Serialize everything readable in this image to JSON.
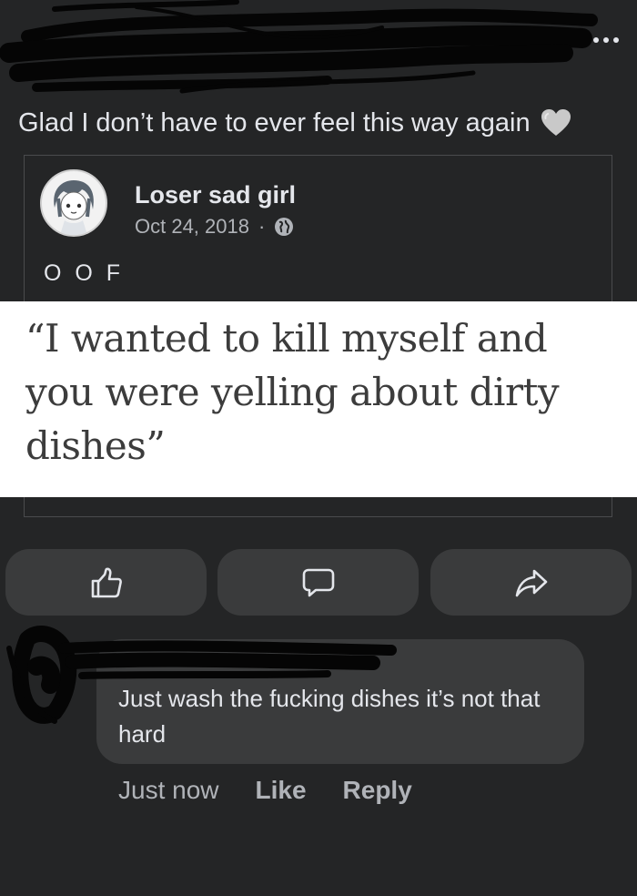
{
  "post": {
    "text": "Glad I don’t have to ever feel this way again",
    "reaction_icon": "grey-heart-icon"
  },
  "shared_post": {
    "author": "Loser sad girl",
    "date": "Oct 24, 2018",
    "separator": "·",
    "privacy_icon": "globe-icon",
    "text": "O O F",
    "quote": "“I wanted to kill myself and you were yelling about dirty dishes”"
  },
  "actions": {
    "like_icon": "thumbs-up-icon",
    "comment_icon": "comment-icon",
    "share_icon": "share-icon"
  },
  "comment": {
    "text": "Just wash the fucking dishes it’s not that hard",
    "time": "Just now",
    "like_label": "Like",
    "reply_label": "Reply"
  },
  "colors": {
    "background": "#242526",
    "button_bg": "#3a3b3c",
    "text_primary": "#e4e6eb",
    "text_secondary": "#b0b3b8"
  }
}
